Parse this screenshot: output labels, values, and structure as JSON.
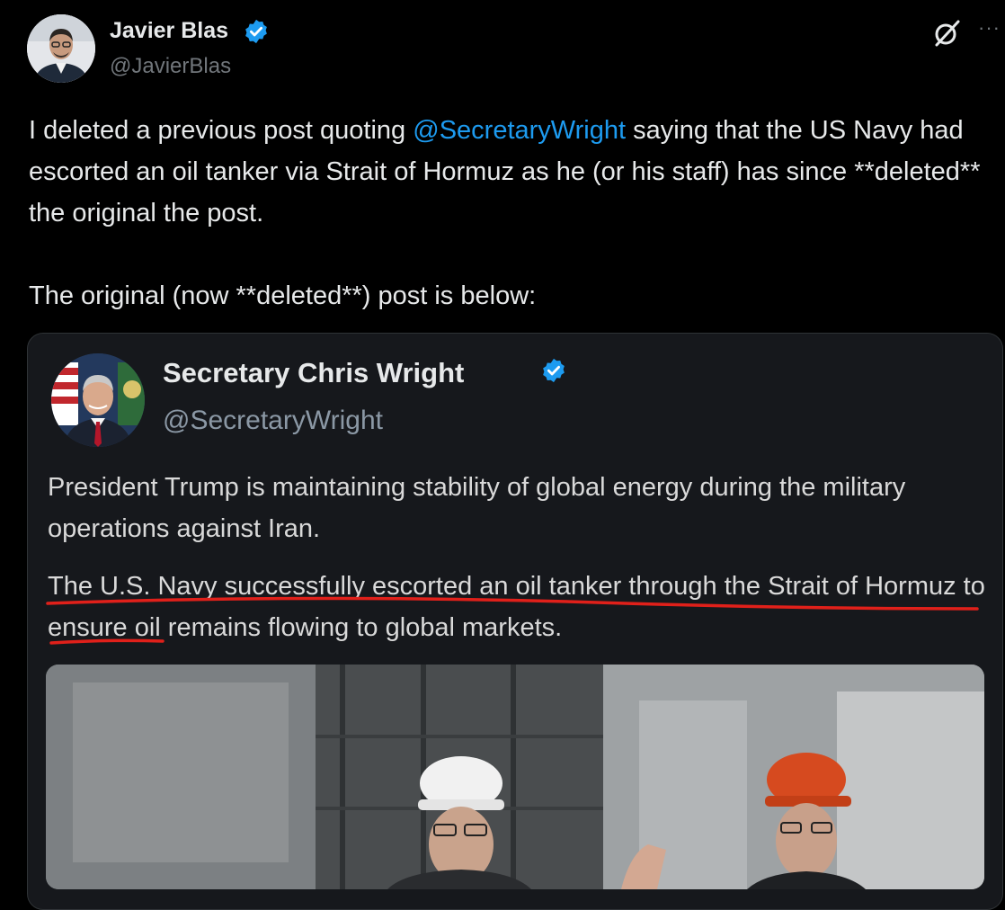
{
  "post": {
    "author_name": "Javier Blas",
    "author_handle": "@JavierBlas",
    "text_1a": "I deleted a previous post quoting ",
    "text_1_mention": "@SecretaryWright",
    "text_1b": " saying that the US Navy had escorted an oil tanker via Strait of Hormuz as he (or his staff) has since **deleted** the original the post.",
    "text_2": "The original (now **deleted**) post is below:"
  },
  "quoted_post": {
    "author_name": "Secretary Chris Wright",
    "author_handle": "@SecretaryWright",
    "text_1": "President Trump is maintaining stability of global energy during the military operations against Iran.",
    "text_2": "The U.S. Navy successfully escorted an oil tanker through the Strait of Hormuz to ensure oil remains flowing to global markets."
  },
  "icons": {
    "verified": "verified-badge-icon",
    "grok": "grok-icon",
    "more": "more-options-icon"
  },
  "colors": {
    "background": "#000000",
    "mention": "#1d9bf0",
    "verified": "#1d9bf0",
    "annotation": "#e0201a"
  }
}
